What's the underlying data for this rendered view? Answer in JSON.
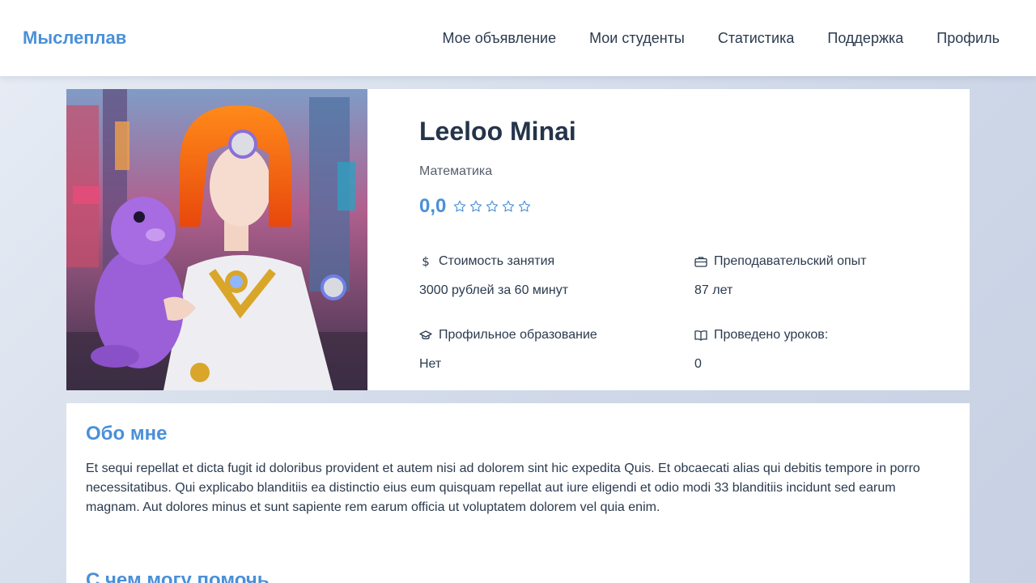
{
  "header": {
    "brand": "Мыслеплав",
    "nav": [
      {
        "label": "Мое объявление"
      },
      {
        "label": "Мои студенты"
      },
      {
        "label": "Статистика"
      },
      {
        "label": "Поддержка"
      },
      {
        "label": "Профиль"
      }
    ]
  },
  "profile": {
    "name": "Leeloo Minai",
    "subject": "Математика",
    "rating": "0,0",
    "stars_filled": 0,
    "stars_total": 5,
    "facts": [
      {
        "icon": "dollar-icon",
        "label": "Стоимость занятия",
        "value": "3000 рублей за 60 минут"
      },
      {
        "icon": "briefcase-icon",
        "label": "Преподавательский опыт",
        "value": "87 лет"
      },
      {
        "icon": "graduation-cap-icon",
        "label": "Профильное образование",
        "value": "Нет"
      },
      {
        "icon": "book-icon",
        "label": "Проведено уроков:",
        "value": "0"
      }
    ]
  },
  "about": {
    "title": "Обо мне",
    "text": "Et sequi repellat et dicta fugit id doloribus provident et autem nisi ad dolorem sint hic expedita Quis. Et obcaecati alias qui debitis tempore in porro necessitatibus. Qui explicabo blanditiis ea distinctio eius eum quisquam repellat aut iure eligendi et odio modi 33 blanditiis incidunt sed earum magnam. Aut dolores minus et sunt sapiente rem earum officia ut voluptatem dolorem vel quia enim.",
    "help_title": "С чем могу помочь"
  },
  "colors": {
    "accent": "#4a90d9",
    "text": "#2b3a4e"
  }
}
